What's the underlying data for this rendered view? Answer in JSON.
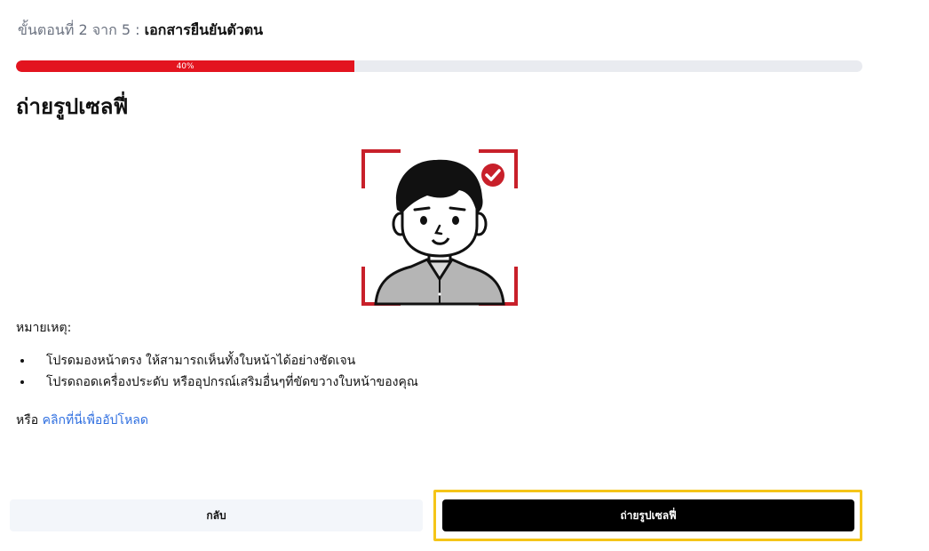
{
  "header": {
    "step_prefix": "ขั้นตอนที่ 2 จาก 5 :",
    "step_doc": "เอกสารยืนยันตัวตน"
  },
  "progress": {
    "label": "40%",
    "value": 40,
    "fill_color": "#e3141f"
  },
  "main": {
    "title": "ถ่ายรูปเซลฟี่",
    "illustration_icon": "selfie-person-face-frame-icon",
    "note_label": "หมายเหตุ:",
    "notes": [
      "โปรดมองหน้าตรง ให้สามารถเห็นทั้งใบหน้าได้อย่างชัดเจน",
      "โปรดถอดเครื่องประดับ หรืออุปกรณ์เสริมอื่นๆที่ขัดขวางใบหน้าของคุณ"
    ],
    "upload_prefix": "หรือ",
    "upload_link": "คลิกที่นี่เพื่ออัปโหลด"
  },
  "footer": {
    "back_label": "กลับ",
    "primary_label": "ถ่ายรูปเซลฟี่"
  },
  "colors": {
    "accent": "#e3141f",
    "link": "#2f6fe0",
    "focus_ring": "#f5c518"
  }
}
